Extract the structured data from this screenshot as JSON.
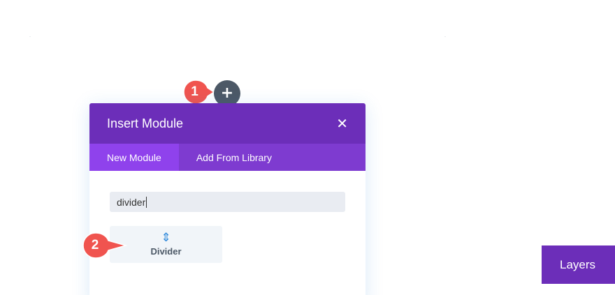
{
  "add_module": {
    "icon": "plus-icon",
    "glyph": "+"
  },
  "modal": {
    "title": "Insert Module",
    "close_glyph": "✕",
    "tabs": [
      {
        "label": "New Module",
        "active": true
      },
      {
        "label": "Add From Library",
        "active": false
      }
    ],
    "search": {
      "value": "divider"
    },
    "results": [
      {
        "label": "Divider",
        "icon": "divider-icon",
        "glyph": "⇕"
      }
    ]
  },
  "callouts": [
    {
      "number": "1"
    },
    {
      "number": "2"
    }
  ],
  "layers_panel": {
    "label": "Layers"
  },
  "colors": {
    "header": "#6c2eb9",
    "tabs": "#7e3bd0",
    "active_tab": "#8f42ec",
    "accent": "#2b87da",
    "callout": "#f0544f",
    "add_button": "#4c5866"
  }
}
